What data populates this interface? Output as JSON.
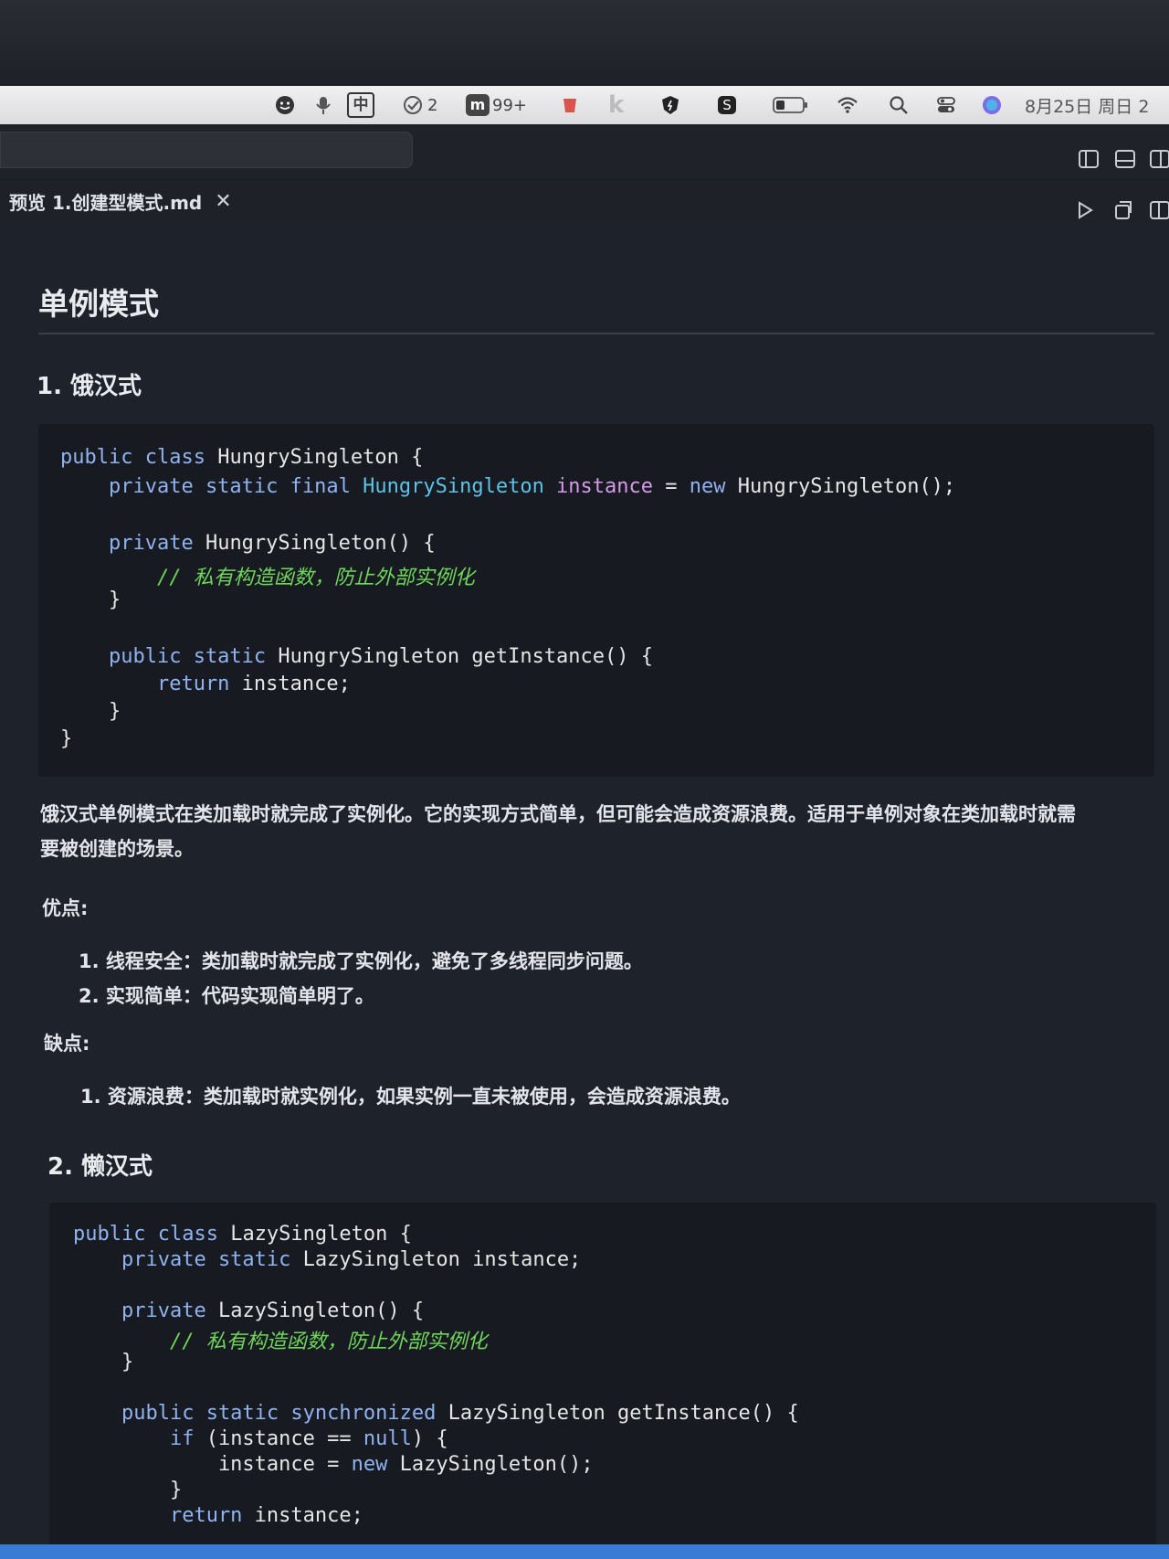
{
  "menubar": {
    "input_method": "中",
    "todo_count": "2",
    "notif_count": "99+",
    "datetime": "8月25日 周日 2"
  },
  "tab": {
    "title": "预览 1.创建型模式.md",
    "close": "✕"
  },
  "doc": {
    "title": "单例模式",
    "section1": {
      "heading": "1. 饿汉式",
      "code": {
        "l1": {
          "a": "public class",
          "b": " HungrySingleton {"
        },
        "l2": {
          "a": "    private static final",
          "b": " HungrySingleton",
          "c": " instance",
          "d": " =",
          "e": " new",
          "f": " HungrySingleton();"
        },
        "l3": {
          "a": "    private",
          "b": " HungrySingleton() {"
        },
        "l4": "        // 私有构造函数，防止外部实例化",
        "l5": "    }",
        "l6": {
          "a": "    public static",
          "b": " HungrySingleton getInstance() {"
        },
        "l7": {
          "a": "        return",
          "b": " instance;"
        },
        "l8": "    }",
        "l9": "}"
      },
      "desc_line1": "饿汉式单例模式在类加载时就完成了实例化。它的实现方式简单，但可能会造成资源浪费。适用于单例对象在类加载时就需",
      "desc_line2": "要被创建的场景。",
      "pros_label": "优点:",
      "pros": [
        "1. 线程安全：类加载时就完成了实例化，避免了多线程同步问题。",
        "2. 实现简单：代码实现简单明了。"
      ],
      "cons_label": "缺点:",
      "cons": [
        "1. 资源浪费：类加载时就实例化，如果实例一直未被使用，会造成资源浪费。"
      ]
    },
    "section2": {
      "heading": "2. 懒汉式",
      "code": {
        "l1": {
          "a": "public class",
          "b": " LazySingleton {"
        },
        "l2": {
          "a": "    private static",
          "b": " LazySingleton instance;"
        },
        "l3": {
          "a": "    private",
          "b": " LazySingleton() {"
        },
        "l4": "        // 私有构造函数，防止外部实例化",
        "l5": "    }",
        "l6": {
          "a": "    public static synchronized",
          "b": " LazySingleton getInstance() {"
        },
        "l7": {
          "a": "        if",
          "b": " (instance ==",
          "c": " null",
          "d": ") {"
        },
        "l8": {
          "a": "            instance =",
          "b": " new",
          "c": " LazySingleton();"
        },
        "l9": "        }",
        "l10": {
          "a": "        return",
          "b": " instance;"
        }
      }
    }
  }
}
